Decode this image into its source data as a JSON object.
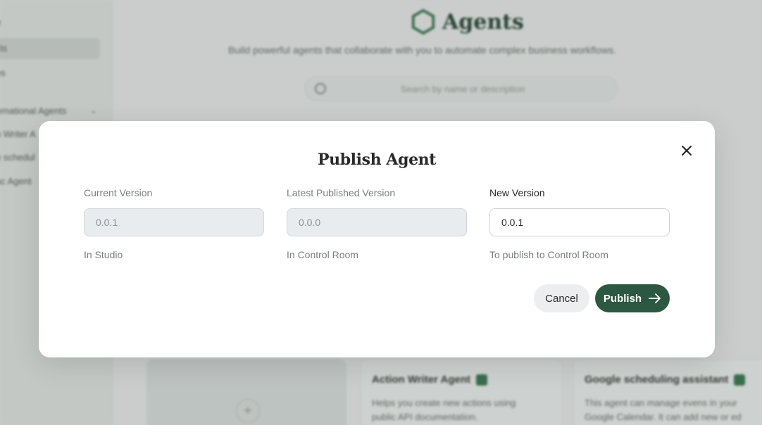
{
  "background": {
    "sidebar_items": [
      {
        "label": "e"
      },
      {
        "label": "ts"
      },
      {
        "label": "es"
      },
      {
        "label": "ernational Agents"
      },
      {
        "label": "n Writer A"
      },
      {
        "label": "e schedul"
      },
      {
        "label": "ac Agent"
      }
    ],
    "header": {
      "title": "Agents",
      "subtitle": "Build powerful agents that collaborate with you to automate complex business workflows."
    },
    "search": {
      "placeholder": "Search by name or description"
    },
    "cards": [
      {
        "title": "Action Writer Agent",
        "desc_line1": "Helps you create new actions using",
        "desc_line2": "public API documentation."
      },
      {
        "title": "Google scheduling assistant",
        "desc_line1": "This agent can manage evens in your",
        "desc_line2": "Google Calendar. It can add new or ed"
      }
    ],
    "add_symbol": "+"
  },
  "modal": {
    "title": "Publish Agent",
    "close_icon": "close-icon",
    "current": {
      "label": "Current Version",
      "value": "0.0.1",
      "hint": "In Studio"
    },
    "latest": {
      "label": "Latest Published Version",
      "value": "0.0.0",
      "hint": "In Control Room"
    },
    "new": {
      "label": "New Version",
      "value": "0.0.1",
      "hint": "To publish to Control Room"
    },
    "cancel_label": "Cancel",
    "publish_label": "Publish",
    "publish_icon": "arrow-right-icon"
  },
  "colors": {
    "accent": "#2c5740",
    "modal_bg": "#ffffff",
    "disabled_field": "#e9ecef"
  }
}
